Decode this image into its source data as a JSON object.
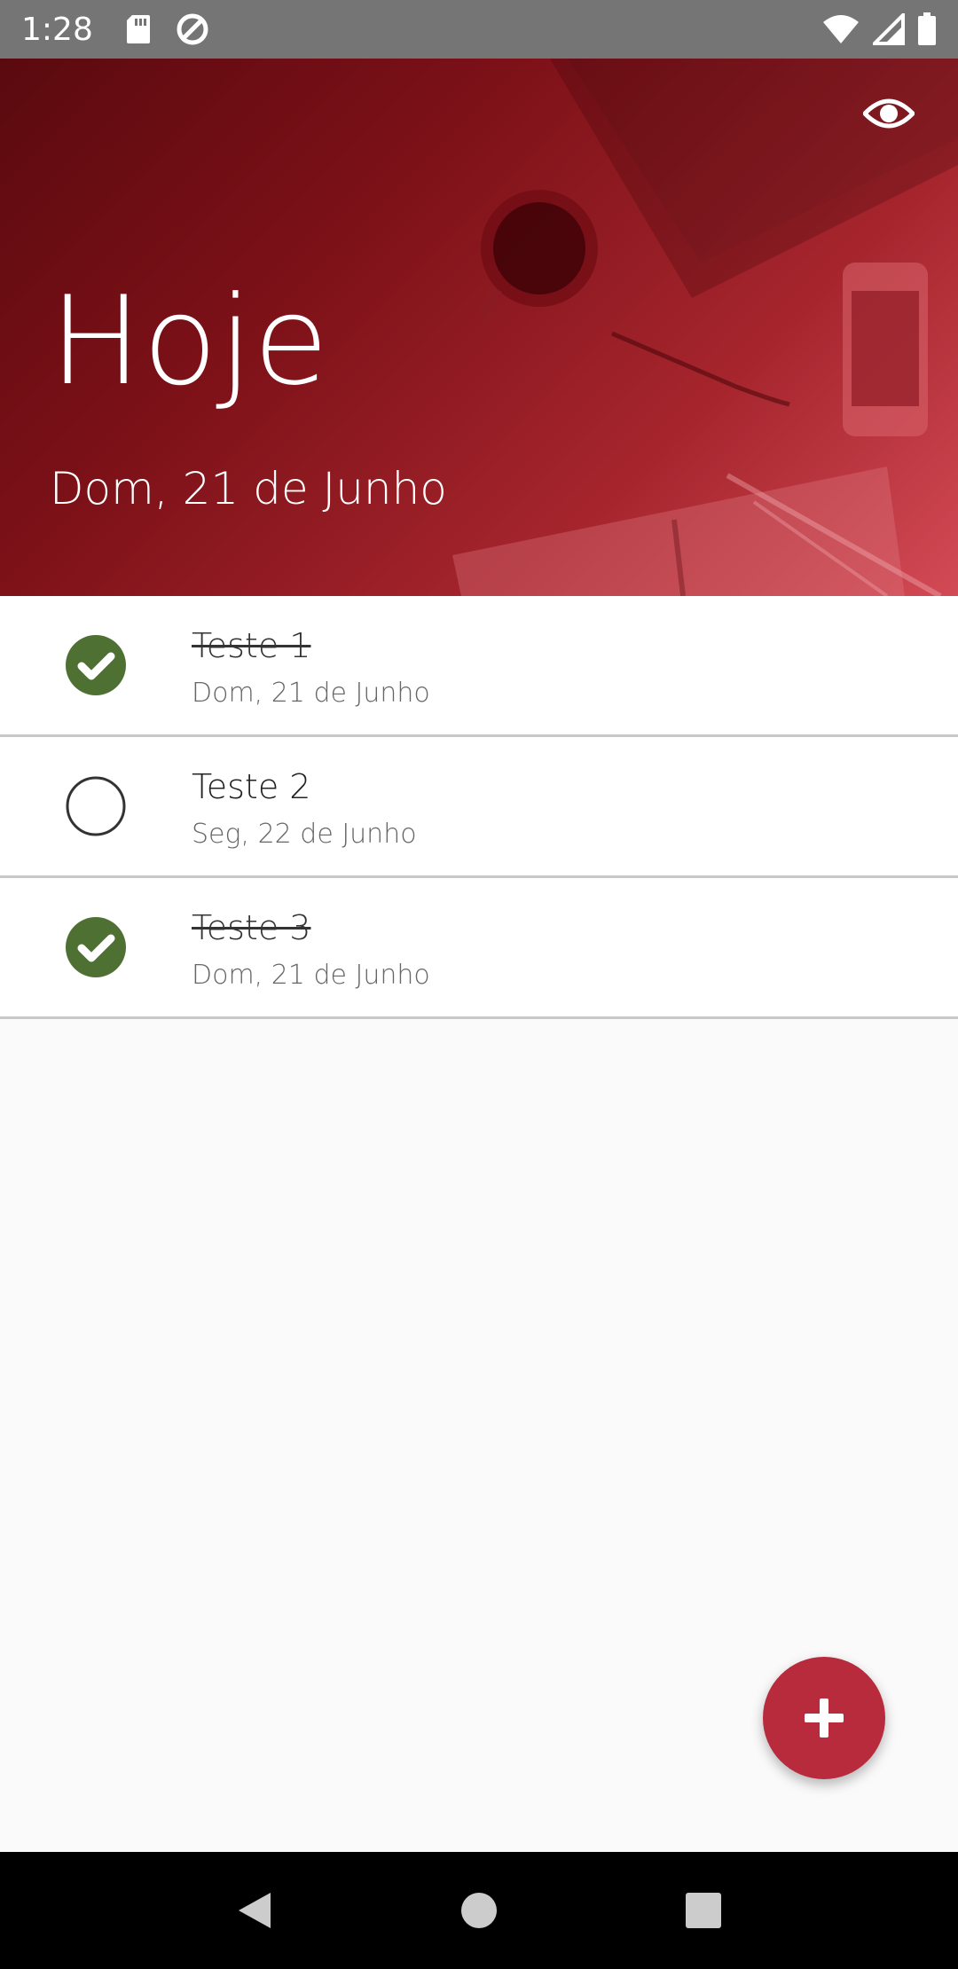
{
  "status_bar": {
    "time": "1:28",
    "icons": [
      "sd-card-icon",
      "data-saver-icon",
      "wifi-icon",
      "signal-icon",
      "battery-icon"
    ]
  },
  "header": {
    "title": "Hoje",
    "date": "Dom, 21 de Junho",
    "action_icon": "eye-icon"
  },
  "tasks": [
    {
      "title": "Teste 1",
      "date": "Dom, 21 de Junho",
      "done": true
    },
    {
      "title": "Teste 2",
      "date": "Seg, 22 de Junho",
      "done": false
    },
    {
      "title": "Teste 3",
      "date": "Dom, 21 de Junho",
      "done": true
    }
  ],
  "fab": {
    "icon": "plus-icon",
    "color": "#b72b3c"
  },
  "colors": {
    "header_dark": "#5a0a0f",
    "header_light": "#d24a55",
    "check_done": "#4f7033",
    "status_bar": "#757575"
  },
  "nav_bar": {
    "icons": [
      "back-icon",
      "home-icon",
      "recents-icon"
    ]
  }
}
